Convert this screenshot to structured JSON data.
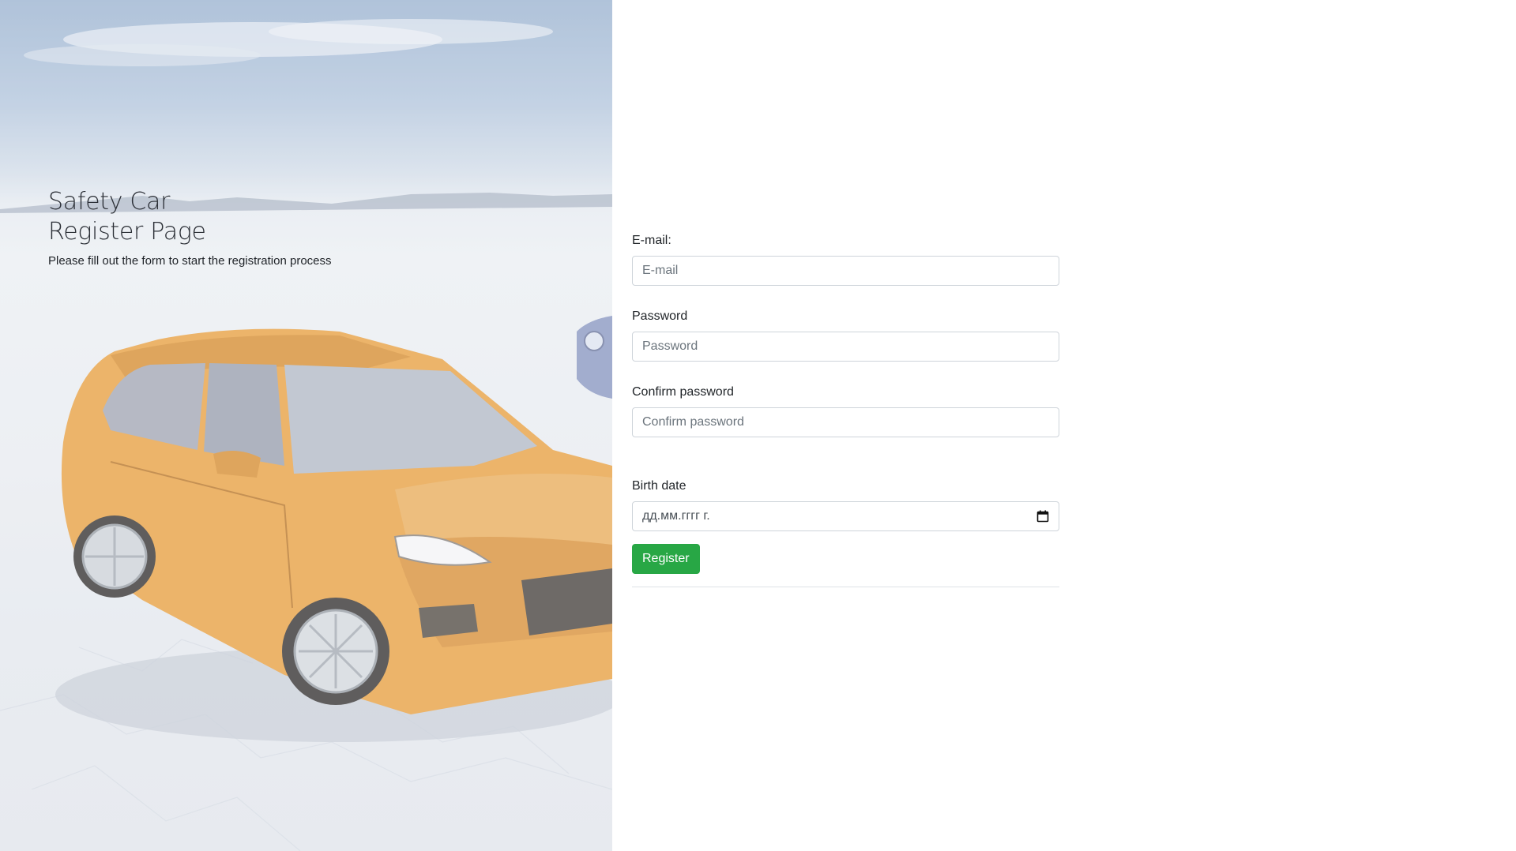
{
  "hero": {
    "title_line1": "Safety Car",
    "title_line2": "Register Page",
    "subtitle": "Please fill out the form to start the registration process"
  },
  "form": {
    "email": {
      "label": "E-mail:",
      "placeholder": "E-mail"
    },
    "password": {
      "label": "Password",
      "placeholder": "Password"
    },
    "confirm_password": {
      "label": "Confirm password",
      "placeholder": "Confirm password"
    },
    "birth_date": {
      "label": "Birth date",
      "placeholder": "дд.мм.гггг г."
    },
    "register_label": "Register"
  },
  "colors": {
    "accent_green": "#28a745",
    "input_border": "#ced4da",
    "car_body": "#e8a44a",
    "sky": "#9fb6d2"
  },
  "icons": {
    "date_picker": "calendar-icon"
  }
}
